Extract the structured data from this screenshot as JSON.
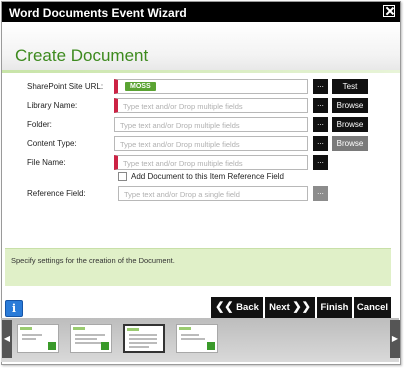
{
  "window": {
    "title": "Word Documents Event Wizard"
  },
  "header": {
    "title": "Create Document"
  },
  "form": {
    "site_url": {
      "label": "SharePoint Site URL:",
      "tag": "MOSS",
      "dots": "...",
      "button": "Test"
    },
    "library": {
      "label": "Library Name:",
      "placeholder": "Type text and/or Drop multiple fields",
      "dots": "...",
      "button": "Browse"
    },
    "folder": {
      "label": "Folder:",
      "placeholder": "Type text and/or Drop multiple fields",
      "dots": "...",
      "button": "Browse"
    },
    "content_type": {
      "label": "Content Type:",
      "placeholder": "Type text and/or Drop multiple fields",
      "dots": "...",
      "button": "Browse"
    },
    "file_name": {
      "label": "File Name:",
      "placeholder": "Type text and/or Drop multiple fields",
      "dots": "..."
    },
    "add_reference": {
      "label": "Add Document to this Item Reference Field",
      "checked": false
    },
    "reference_field": {
      "label": "Reference Field:",
      "placeholder": "Type text and/or Drop a single field",
      "dots": "..."
    }
  },
  "status": {
    "text": "Specify settings for the creation of the Document."
  },
  "nav": {
    "info": "i",
    "back": "Back",
    "next": "Next",
    "finish": "Finish",
    "cancel": "Cancel"
  },
  "thumbnails": {
    "selected_index": 2
  }
}
